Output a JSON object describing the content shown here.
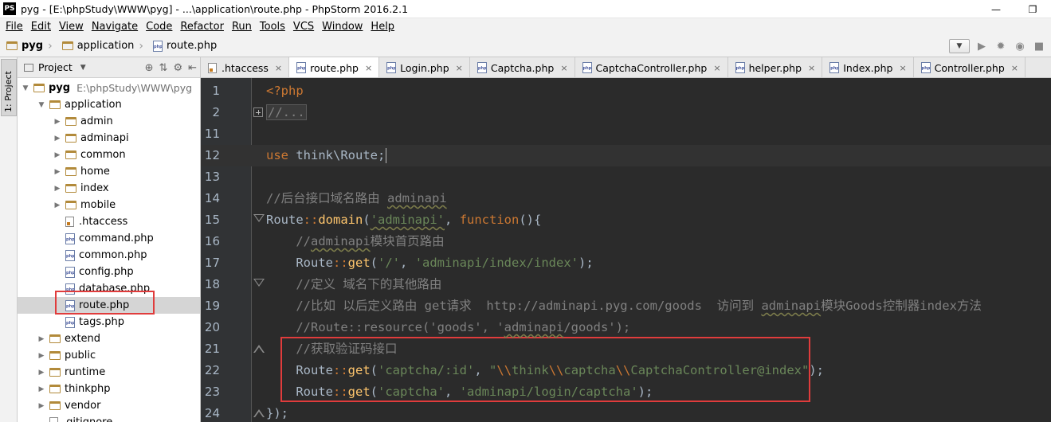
{
  "window": {
    "title": "pyg - [E:\\phpStudy\\WWW\\pyg] - ...\\application\\route.php - PhpStorm 2016.2.1",
    "logo": "PS",
    "minimize_icon": "minimize-icon",
    "restore_icon": "restore-icon"
  },
  "menu": {
    "items": [
      "File",
      "Edit",
      "View",
      "Navigate",
      "Code",
      "Refactor",
      "Run",
      "Tools",
      "VCS",
      "Window",
      "Help"
    ]
  },
  "breadcrumb": {
    "items": [
      "pyg",
      "application",
      "route.php"
    ]
  },
  "project_panel": {
    "title": "Project",
    "tree": [
      {
        "label": "pyg",
        "path": "E:\\phpStudy\\WWW\\pyg",
        "type": "folder",
        "expanded": true,
        "depth": 0
      },
      {
        "label": "application",
        "type": "folder",
        "expanded": true,
        "depth": 1
      },
      {
        "label": "admin",
        "type": "folder",
        "expanded": false,
        "depth": 2
      },
      {
        "label": "adminapi",
        "type": "folder",
        "expanded": false,
        "depth": 2
      },
      {
        "label": "common",
        "type": "folder",
        "expanded": false,
        "depth": 2
      },
      {
        "label": "home",
        "type": "folder",
        "expanded": false,
        "depth": 2
      },
      {
        "label": "index",
        "type": "folder",
        "expanded": false,
        "depth": 2
      },
      {
        "label": "mobile",
        "type": "folder",
        "expanded": false,
        "depth": 2
      },
      {
        "label": ".htaccess",
        "type": "htaccess",
        "depth": 2
      },
      {
        "label": "command.php",
        "type": "php",
        "depth": 2
      },
      {
        "label": "common.php",
        "type": "php",
        "depth": 2
      },
      {
        "label": "config.php",
        "type": "php",
        "depth": 2
      },
      {
        "label": "database.php",
        "type": "php",
        "depth": 2
      },
      {
        "label": "route.php",
        "type": "php",
        "depth": 2,
        "selected": true
      },
      {
        "label": "tags.php",
        "type": "php",
        "depth": 2
      },
      {
        "label": "extend",
        "type": "folder",
        "expanded": false,
        "depth": 1
      },
      {
        "label": "public",
        "type": "folder",
        "expanded": false,
        "depth": 1
      },
      {
        "label": "runtime",
        "type": "folder",
        "expanded": false,
        "depth": 1
      },
      {
        "label": "thinkphp",
        "type": "folder",
        "expanded": false,
        "depth": 1
      },
      {
        "label": "vendor",
        "type": "folder",
        "expanded": false,
        "depth": 1
      },
      {
        "label": ".gitignore",
        "type": "text",
        "depth": 1
      }
    ]
  },
  "toolstrip": {
    "tab_label": "1: Project"
  },
  "editor_tabs": [
    {
      "label": ".htaccess",
      "type": "htaccess",
      "active": false
    },
    {
      "label": "route.php",
      "type": "php",
      "active": true
    },
    {
      "label": "Login.php",
      "type": "php",
      "active": false
    },
    {
      "label": "Captcha.php",
      "type": "php",
      "active": false
    },
    {
      "label": "CaptchaController.php",
      "type": "php",
      "active": false
    },
    {
      "label": "helper.php",
      "type": "php",
      "active": false
    },
    {
      "label": "Index.php",
      "type": "php",
      "active": false
    },
    {
      "label": "Controller.php",
      "type": "php",
      "active": false
    }
  ],
  "code_lines": [
    {
      "n": "1",
      "fold": "",
      "segs": [
        [
          "tag",
          "<?php"
        ]
      ]
    },
    {
      "n": "2",
      "fold": "plus",
      "segs": [
        [
          "collapsed",
          "//..."
        ]
      ]
    },
    {
      "n": "11",
      "fold": "",
      "segs": []
    },
    {
      "n": "12",
      "fold": "",
      "caret": true,
      "segs": [
        [
          "kw",
          "use "
        ],
        [
          "plain",
          "think\\Route;"
        ]
      ]
    },
    {
      "n": "13",
      "fold": "",
      "segs": []
    },
    {
      "n": "14",
      "fold": "",
      "segs": [
        [
          "com",
          "//后台接口域名路由 "
        ],
        [
          "comsq",
          "adminapi"
        ]
      ]
    },
    {
      "n": "15",
      "fold": "open",
      "segs": [
        [
          "plain",
          "Route"
        ],
        [
          "op",
          "::"
        ],
        [
          "fn",
          "domain"
        ],
        [
          "plain",
          "("
        ],
        [
          "strsq",
          "'adminapi'"
        ],
        [
          "plain",
          ", "
        ],
        [
          "kw",
          "function"
        ],
        [
          "plain",
          "(){"
        ]
      ]
    },
    {
      "n": "16",
      "fold": "",
      "segs": [
        [
          "com",
          "    //"
        ],
        [
          "comsq",
          "adminapi"
        ],
        [
          "com",
          "模块首页路由"
        ]
      ]
    },
    {
      "n": "17",
      "fold": "",
      "segs": [
        [
          "plain",
          "    Route"
        ],
        [
          "op",
          "::"
        ],
        [
          "fn",
          "get"
        ],
        [
          "plain",
          "("
        ],
        [
          "str",
          "'/'"
        ],
        [
          "plain",
          ", "
        ],
        [
          "str",
          "'adminapi/index/index'"
        ],
        [
          "plain",
          ");"
        ]
      ]
    },
    {
      "n": "18",
      "fold": "open",
      "segs": [
        [
          "com",
          "    //定义 域名下的其他路由"
        ]
      ]
    },
    {
      "n": "19",
      "fold": "",
      "segs": [
        [
          "com",
          "    //比如 以后定义路由 get请求  http://adminapi.pyg.com/goods  访问到 "
        ],
        [
          "comsq",
          "adminapi"
        ],
        [
          "com",
          "模块Goods控制器index方法"
        ]
      ]
    },
    {
      "n": "20",
      "fold": "",
      "segs": [
        [
          "com",
          "    //Route::resource('goods', '"
        ],
        [
          "comsq",
          "adminapi"
        ],
        [
          "com",
          "/goods');"
        ]
      ]
    },
    {
      "n": "21",
      "fold": "close",
      "segs": [
        [
          "com",
          "    //获取验证码接口"
        ]
      ]
    },
    {
      "n": "22",
      "fold": "",
      "segs": [
        [
          "plain",
          "    Route"
        ],
        [
          "op",
          "::"
        ],
        [
          "fn",
          "get"
        ],
        [
          "plain",
          "("
        ],
        [
          "str",
          "'captcha/:id'"
        ],
        [
          "plain",
          ", "
        ],
        [
          "str",
          "\""
        ],
        [
          "esc",
          "\\\\"
        ],
        [
          "str",
          "think"
        ],
        [
          "esc",
          "\\\\"
        ],
        [
          "str",
          "captcha"
        ],
        [
          "esc",
          "\\\\"
        ],
        [
          "str",
          "CaptchaController@index\""
        ],
        [
          "plain",
          ");"
        ]
      ]
    },
    {
      "n": "23",
      "fold": "",
      "segs": [
        [
          "plain",
          "    Route"
        ],
        [
          "op",
          "::"
        ],
        [
          "fn",
          "get"
        ],
        [
          "plain",
          "("
        ],
        [
          "str",
          "'captcha'"
        ],
        [
          "plain",
          ", "
        ],
        [
          "str",
          "'adminapi/login/captcha'"
        ],
        [
          "plain",
          ");"
        ]
      ]
    },
    {
      "n": "24",
      "fold": "close",
      "segs": [
        [
          "plain",
          "});"
        ]
      ]
    }
  ],
  "colors": {
    "editor_bg": "#2b2b2b",
    "gutter_bg": "#313335",
    "keyword": "#cc7832",
    "string": "#6a8759",
    "comment": "#808080",
    "function": "#ffc66d",
    "highlight_box": "#e03c3c"
  }
}
